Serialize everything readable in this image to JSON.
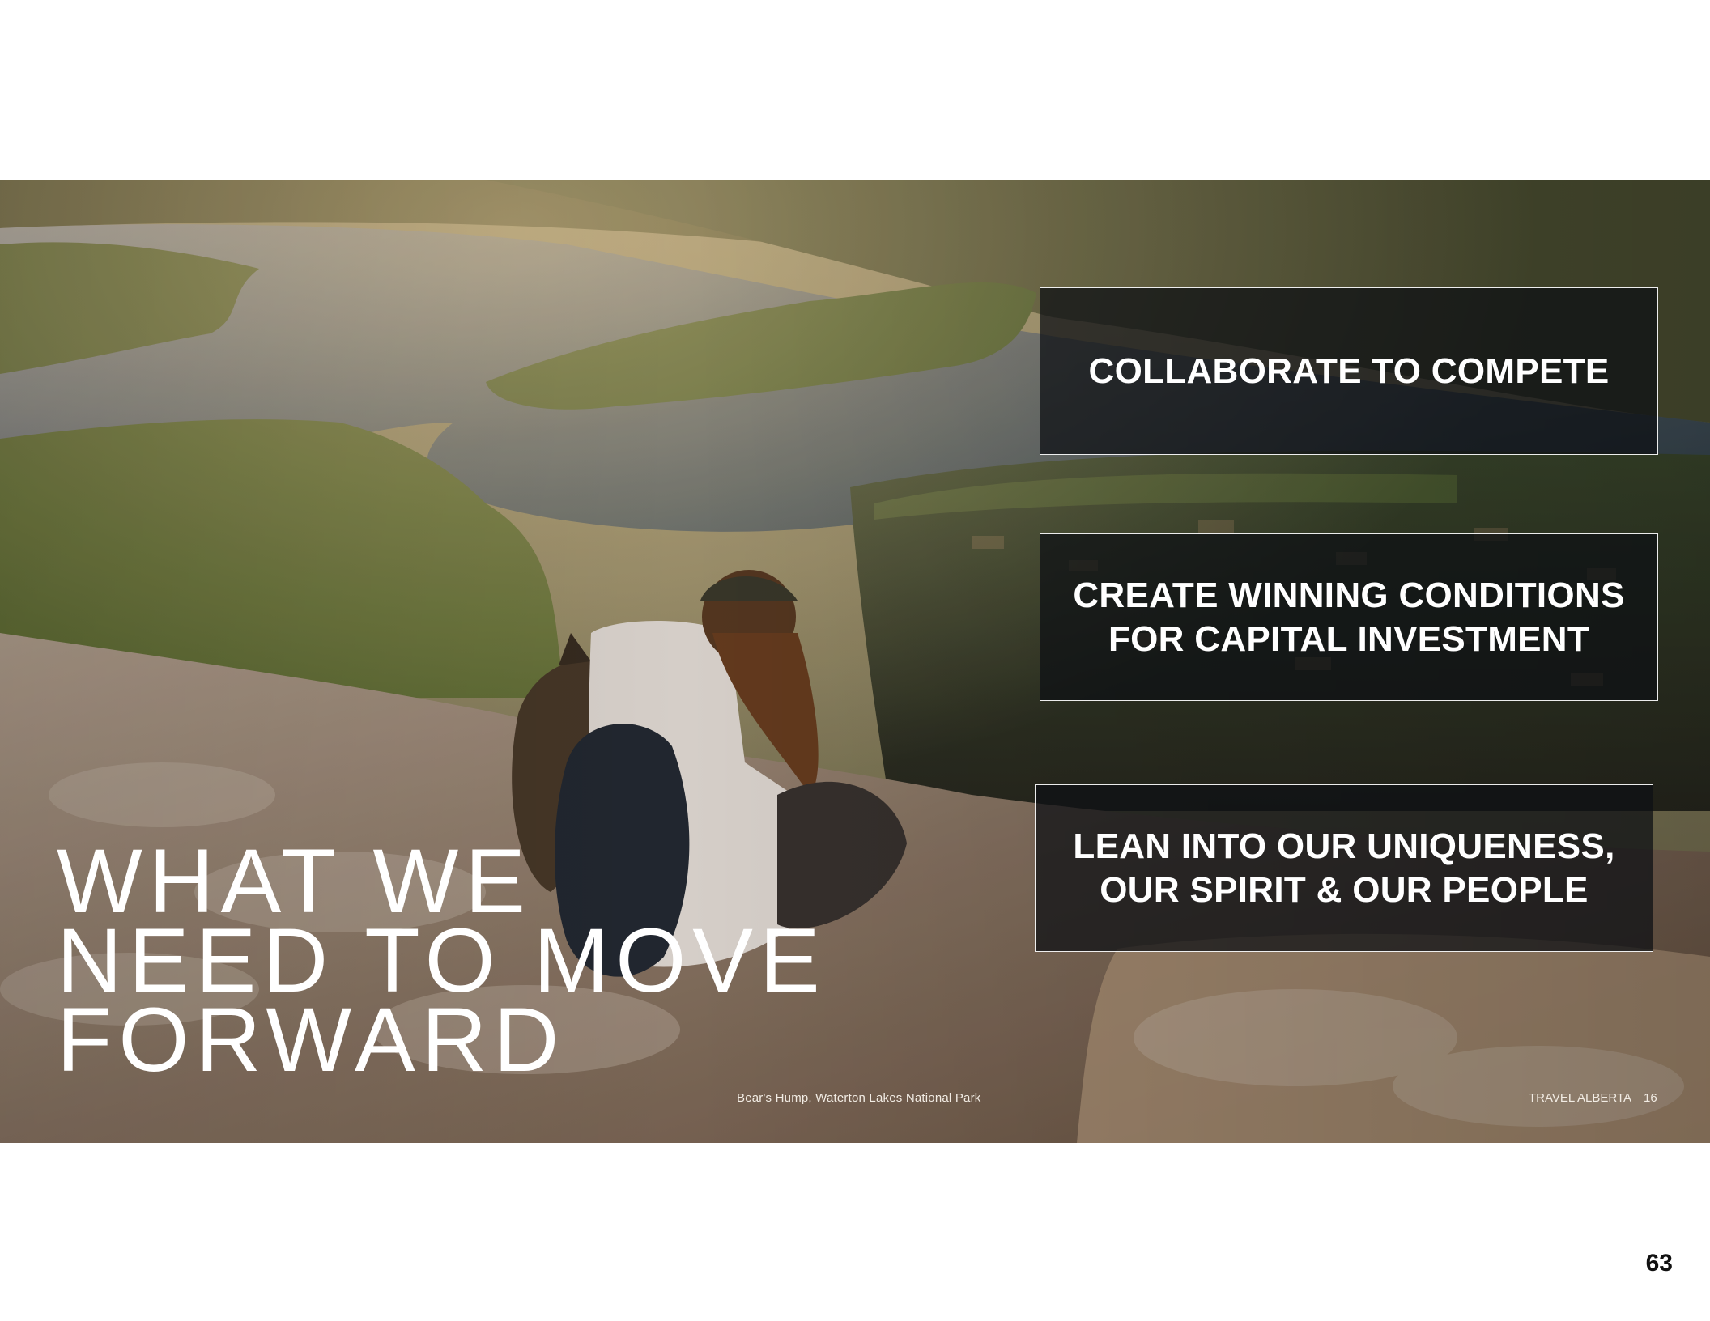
{
  "callouts": [
    "COLLABORATE TO COMPETE",
    "CREATE WINNING CONDITIONS\nFOR CAPITAL INVESTMENT",
    "LEAN INTO OUR UNIQUENESS,\nOUR SPIRIT & OUR PEOPLE"
  ],
  "headline": {
    "lines": [
      "WHAT WE",
      "NEED TO MOVE",
      "FORWARD"
    ]
  },
  "caption": "Bear's Hump, Waterton Lakes National Park",
  "footer": {
    "brand": "TRAVEL ALBERTA",
    "page": "16"
  },
  "page_number": "63",
  "colors": {
    "callout_bg": "#0e1014",
    "callout_border": "#ffffff",
    "text": "#ffffff",
    "page_number": "#111111"
  }
}
